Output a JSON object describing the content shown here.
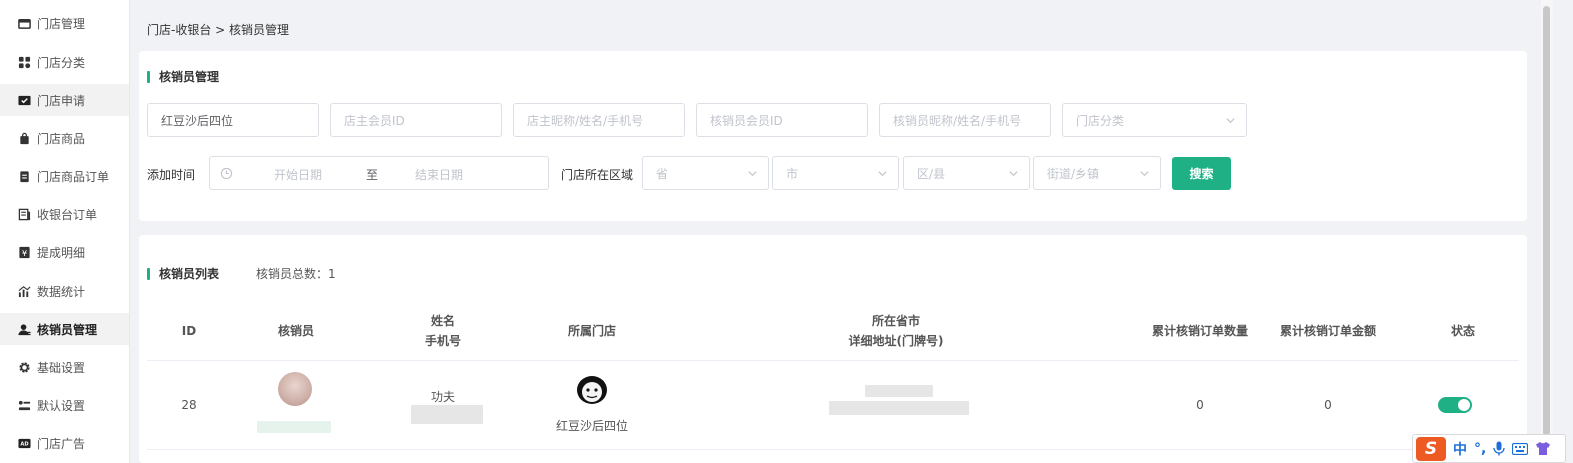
{
  "sidebar": {
    "items": [
      {
        "label": "门店管理",
        "icon": "store-icon"
      },
      {
        "label": "门店分类",
        "icon": "category-grid-icon"
      },
      {
        "label": "门店申请",
        "icon": "application-icon"
      },
      {
        "label": "门店商品",
        "icon": "shopping-bag-icon"
      },
      {
        "label": "门店商品订单",
        "icon": "order-clipboard-icon"
      },
      {
        "label": "收银台订单",
        "icon": "cashier-order-icon"
      },
      {
        "label": "提成明细",
        "icon": "commission-yen-icon"
      },
      {
        "label": "数据统计",
        "icon": "statistics-chart-icon"
      },
      {
        "label": "核销员管理",
        "icon": "user-manage-icon"
      },
      {
        "label": "基础设置",
        "icon": "gear-icon"
      },
      {
        "label": "默认设置",
        "icon": "default-settings-icon"
      },
      {
        "label": "门店广告",
        "icon": "ad-icon"
      }
    ]
  },
  "breadcrumb": "门店-收银台 > 核销员管理",
  "filter": {
    "title": "核销员管理",
    "store_name_value": "红豆沙后四位",
    "owner_member_id_placeholder": "店主会员ID",
    "owner_name_placeholder": "店主昵称/姓名/手机号",
    "verifier_member_id_placeholder": "核销员会员ID",
    "verifier_name_placeholder": "核销员昵称/姓名/手机号",
    "store_category_placeholder": "门店分类",
    "add_time_label": "添加时间",
    "start_date_placeholder": "开始日期",
    "date_separator": "至",
    "end_date_placeholder": "结束日期",
    "region_label": "门店所在区域",
    "province_placeholder": "省",
    "city_placeholder": "市",
    "district_placeholder": "区/县",
    "street_placeholder": "街道/乡镇",
    "search_label": "搜索"
  },
  "list": {
    "title": "核销员列表",
    "total_label": "核销员总数：1",
    "headers": {
      "id": "ID",
      "verifier": "核销员",
      "name": "姓名",
      "phone": "手机号",
      "store": "所属门店",
      "province_city": "所在省市",
      "address": "详细地址(门牌号)",
      "total_orders": "累计核销订单数量",
      "total_amount": "累计核销订单金额",
      "status": "状态"
    },
    "rows": [
      {
        "id": "28",
        "name": "功夫",
        "store": "红豆沙后四位",
        "total_orders": "0",
        "total_amount": "0",
        "status_on": true
      }
    ]
  },
  "ime": {
    "lang": "中",
    "punct": "°,"
  },
  "colors": {
    "accent": "#1fb185",
    "ime_brand": "#ee5a24"
  }
}
